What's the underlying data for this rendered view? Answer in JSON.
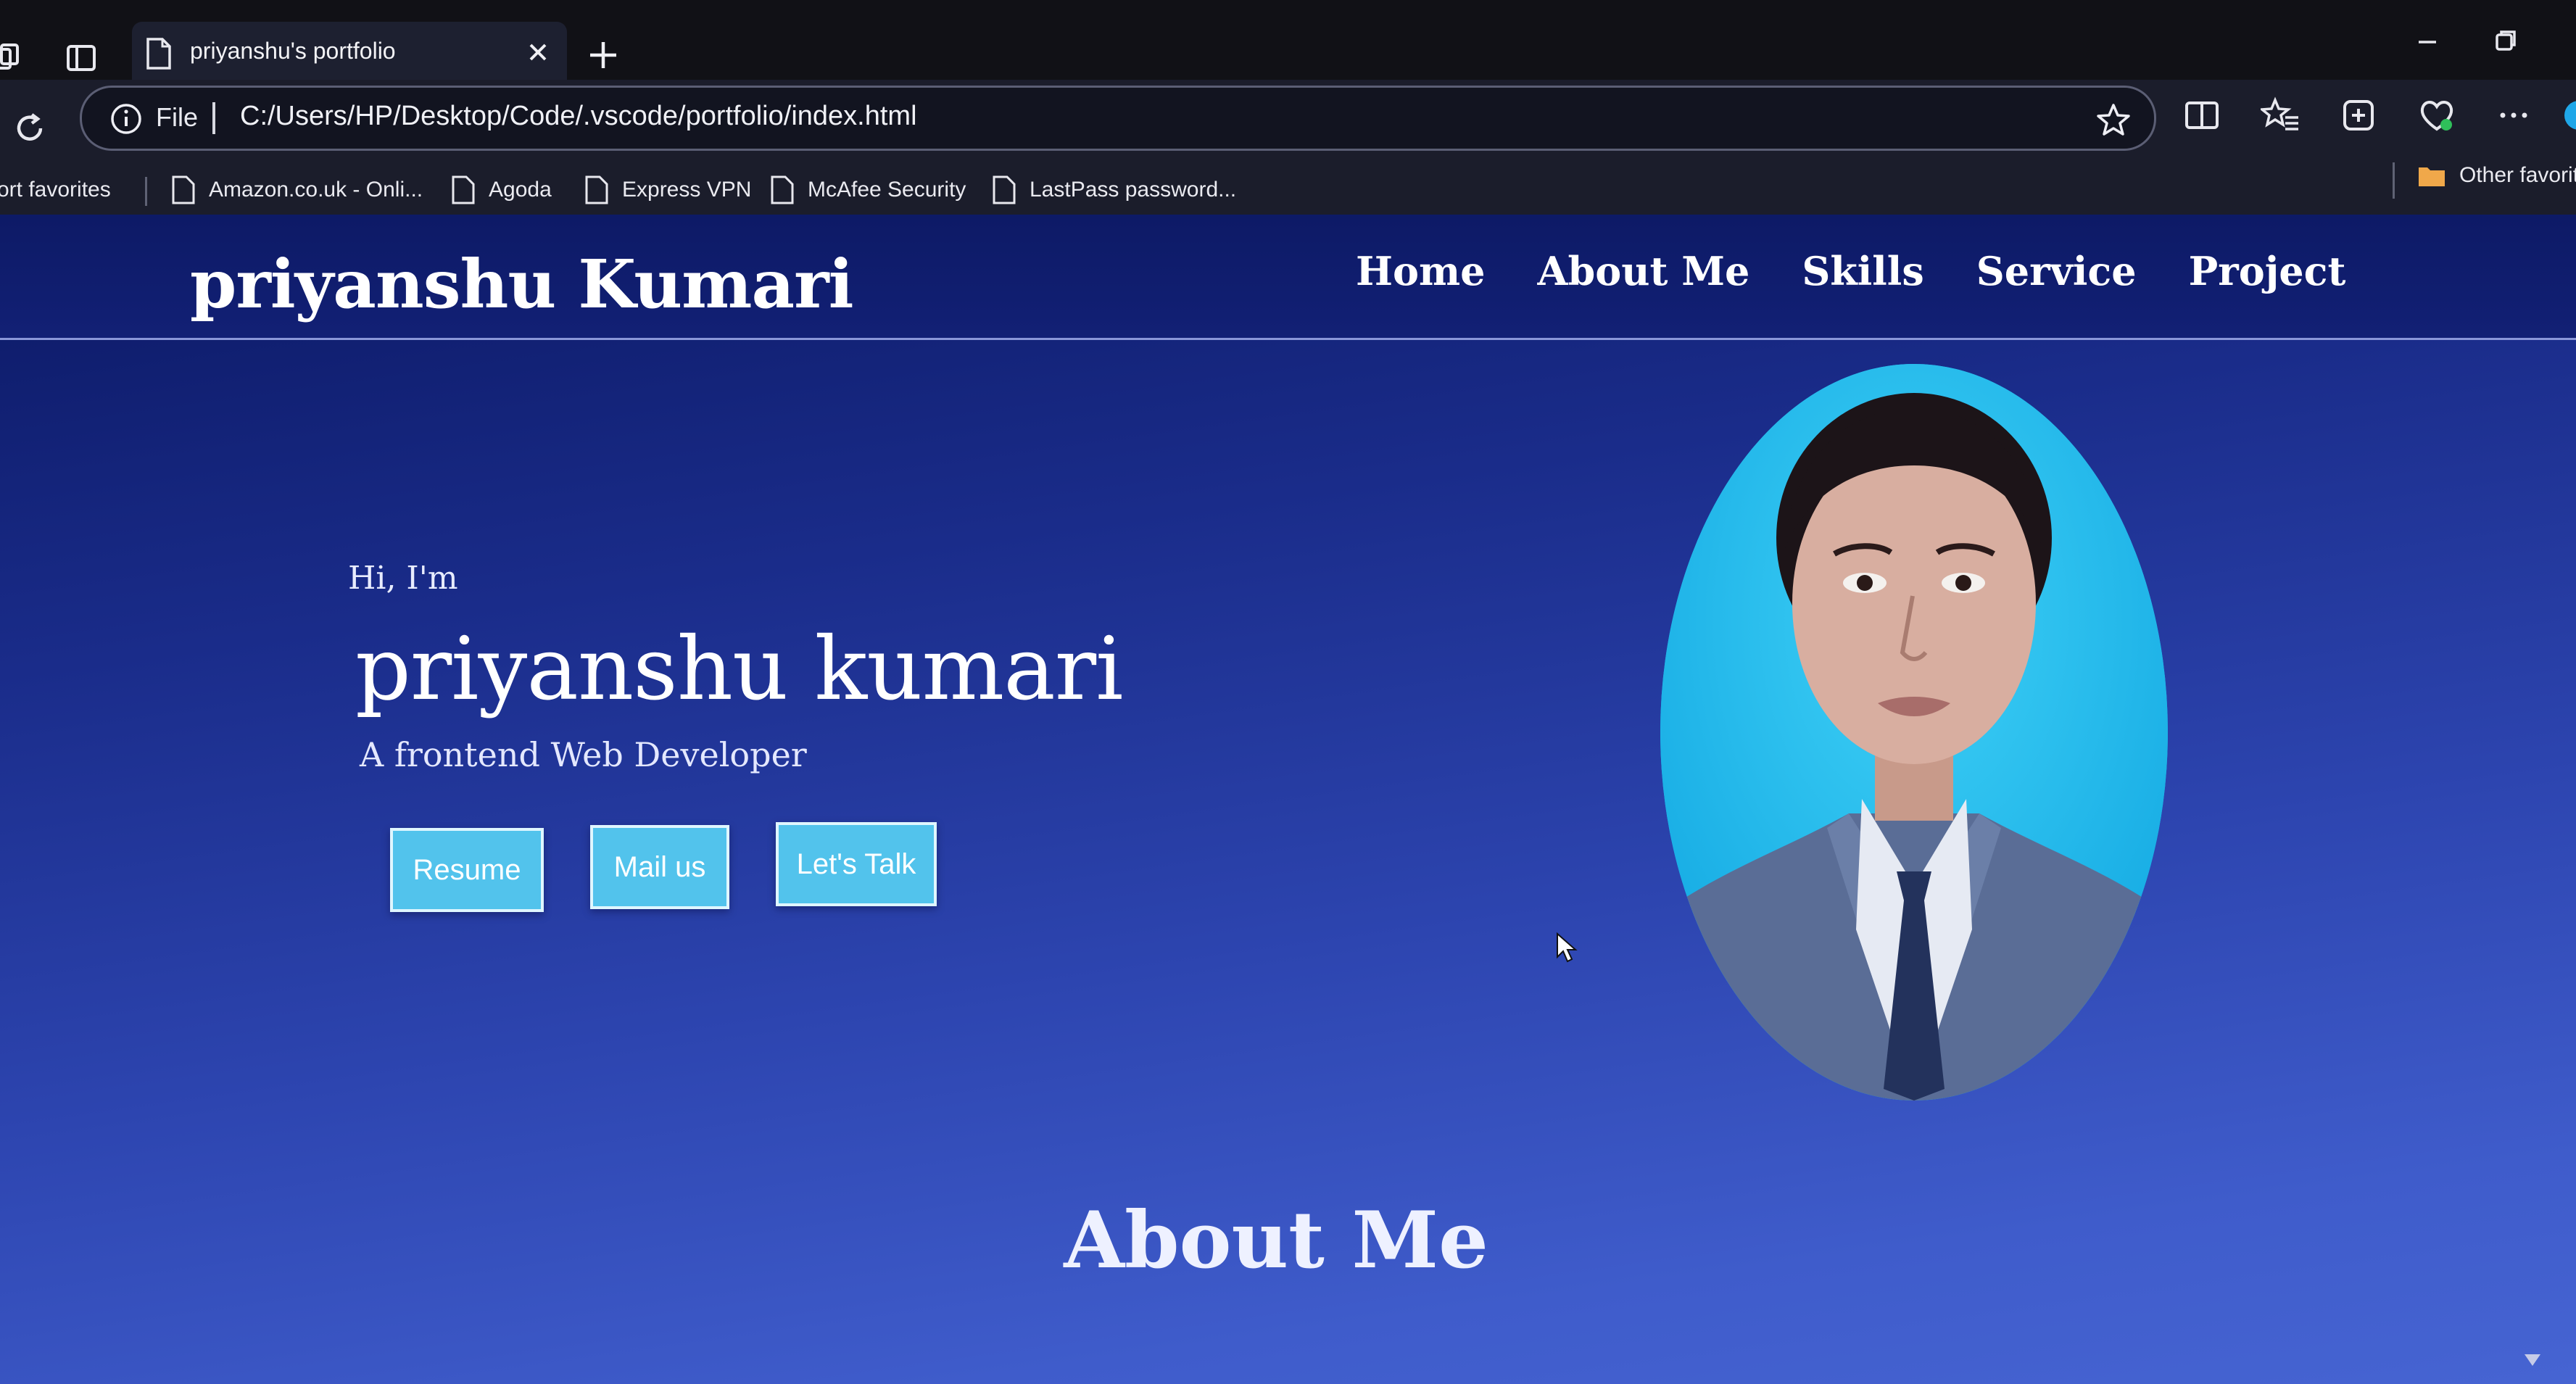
{
  "browser": {
    "tab": {
      "title": "priyanshu's portfolio",
      "icon": "page-icon"
    },
    "address": {
      "scheme": "File",
      "url": "C:/Users/HP/Desktop/Code/.vscode/portfolio/index.html"
    },
    "bookmarks": [
      {
        "label": "ort favorites"
      },
      {
        "label": "Amazon.co.uk - Onli..."
      },
      {
        "label": "Agoda"
      },
      {
        "label": "Express VPN"
      },
      {
        "label": "McAfee Security"
      },
      {
        "label": "LastPass password..."
      }
    ],
    "other_favorites": "Other favorit"
  },
  "page": {
    "brand": "priyanshu Kumari",
    "nav": [
      "Home",
      "About Me",
      "Skills",
      "Service",
      "Project"
    ],
    "hero": {
      "greeting": "Hi, I'm",
      "name": "priyanshu kumari",
      "tagline": "A frontend Web Developer",
      "buttons": [
        "Resume",
        "Mail us",
        "Let's Talk"
      ]
    },
    "about_heading": "About Me"
  },
  "colors": {
    "accent_button": "#52c3ec",
    "page_bg_top": "#0b1863",
    "page_bg_bottom": "#4664d2",
    "photo_bg": "#1eb9ee"
  }
}
